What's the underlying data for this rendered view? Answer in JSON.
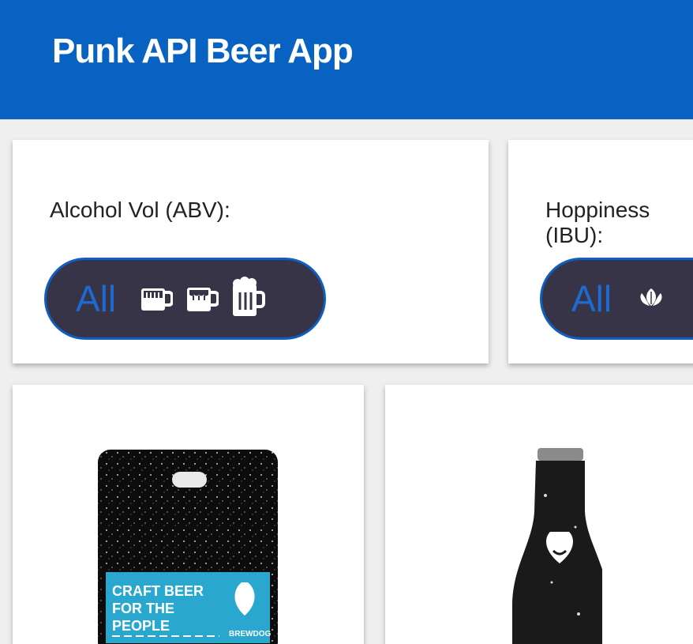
{
  "header": {
    "title": "Punk API Beer App"
  },
  "filters": {
    "abv": {
      "label": "Alcohol Vol (ABV):",
      "all_label": "All",
      "options": [
        "mug-low-icon",
        "mug-medium-icon",
        "mug-high-icon"
      ]
    },
    "ibu": {
      "label": "Hoppiness (IBU):",
      "all_label": "All",
      "options": [
        "hop-icon"
      ]
    }
  },
  "beers": [
    {
      "image": "beer-can-image",
      "can_text": [
        "CRAFT BEER",
        "FOR THE",
        "PEOPLE"
      ],
      "brand": "BREWDOG"
    },
    {
      "image": "beer-bottle-image"
    }
  ],
  "colors": {
    "header": "#0862c1",
    "pill_bg": "#363446",
    "pill_border": "#0f5fc0",
    "accent": "#1e6ad1",
    "can_label": "#2aa7cf"
  }
}
